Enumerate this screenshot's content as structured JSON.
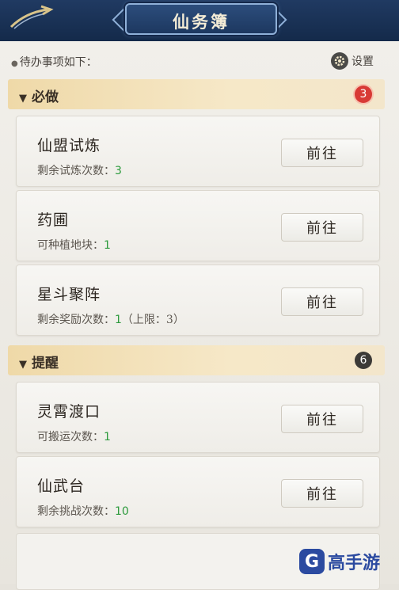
{
  "header": {
    "title": "仙务簿"
  },
  "subheading": "待办事项如下：",
  "settings_label": "设置",
  "sections": [
    {
      "title": "必做",
      "badge": "3",
      "badge_color": "#d83a35"
    },
    {
      "title": "提醒",
      "badge": "6",
      "badge_color": "#3c3a37"
    }
  ],
  "tasks": [
    {
      "title": "仙盟试炼",
      "sub_label": "剩余试炼次数：",
      "value": "3",
      "extra": "",
      "button": "前往"
    },
    {
      "title": "药圃",
      "sub_label": "可种植地块：",
      "value": "1",
      "extra": "",
      "button": "前往"
    },
    {
      "title": "星斗聚阵",
      "sub_label": "剩余奖励次数：",
      "value": "1",
      "extra": "（上限：3）",
      "button": "前往"
    },
    {
      "title": "灵霄渡口",
      "sub_label": "可搬运次数：",
      "value": "1",
      "extra": "",
      "button": "前往"
    },
    {
      "title": "仙武台",
      "sub_label": "剩余挑战次数：",
      "value": "10",
      "extra": "",
      "button": "前往"
    }
  ],
  "watermark": {
    "logo": "G",
    "text": "高手游"
  },
  "colors": {
    "accent_blue": "#1d3860",
    "value_green": "#2c9a3c"
  }
}
